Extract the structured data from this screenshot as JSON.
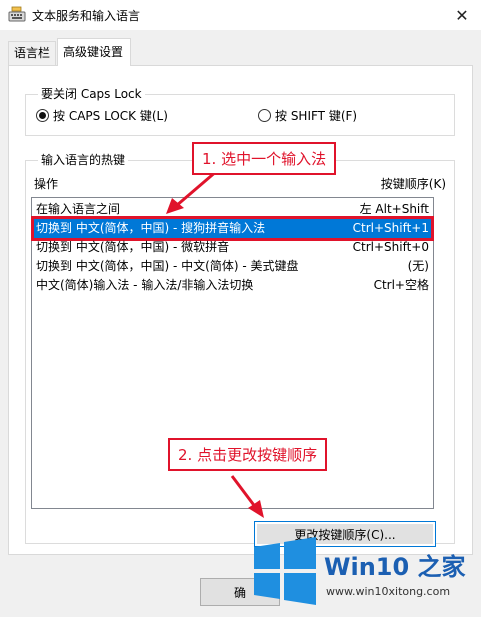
{
  "window": {
    "title": "文本服务和输入语言"
  },
  "tabs": [
    {
      "label": "语言栏",
      "active": false
    },
    {
      "label": "高级键设置",
      "active": true
    }
  ],
  "caps_lock": {
    "title": "要关闭 Caps Lock",
    "options": [
      {
        "label": "按 CAPS LOCK 键(L)",
        "checked": true
      },
      {
        "label": "按 SHIFT 键(F)",
        "checked": false
      }
    ]
  },
  "hotkeys": {
    "title": "输入语言的热键",
    "col_action": "操作",
    "col_key": "按键顺序(K)",
    "rows": [
      {
        "action": "在输入语言之间",
        "key": "左 Alt+Shift",
        "selected": false
      },
      {
        "action": "切换到 中文(简体，中国) - 搜狗拼音输入法",
        "key": "Ctrl+Shift+1",
        "selected": true
      },
      {
        "action": "切换到 中文(简体，中国) - 微软拼音",
        "key": "Ctrl+Shift+0",
        "selected": false
      },
      {
        "action": "切换到 中文(简体，中国) - 中文(简体) - 美式键盘",
        "key": "(无)",
        "selected": false
      },
      {
        "action": "中文(简体)输入法 - 输入法/非输入法切换",
        "key": "Ctrl+空格",
        "selected": false
      }
    ],
    "change_button": "更改按键顺序(C)..."
  },
  "footer": {
    "ok_label": "确"
  },
  "annotations": {
    "step1": "1. 选中一个输入法",
    "step2": "2. 点击更改按键顺序",
    "color": "#e0132b"
  },
  "watermark": {
    "brand": "Win10 之家",
    "url": "www.win10xitong.com",
    "color": "#1b5fb2"
  }
}
